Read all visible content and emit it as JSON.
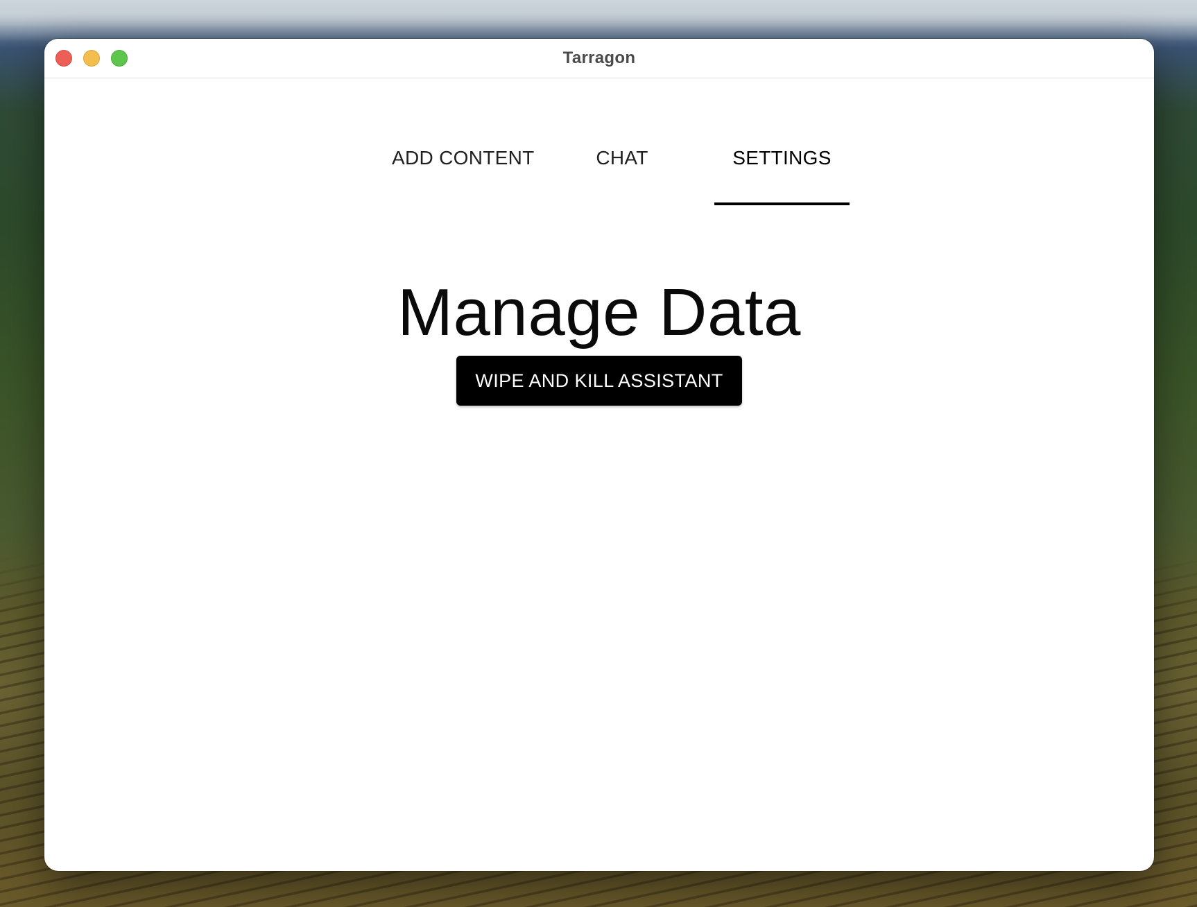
{
  "window": {
    "title": "Tarragon"
  },
  "tabs": [
    {
      "label": "ADD CONTENT",
      "active": false
    },
    {
      "label": "CHAT",
      "active": false
    },
    {
      "label": "SETTINGS",
      "active": true
    }
  ],
  "settings": {
    "heading": "Manage Data",
    "wipe_button_label": "WIPE AND KILL ASSISTANT"
  },
  "colors": {
    "accent": "#000000",
    "background": "#ffffff",
    "close_light": "#ec5f57",
    "minimize_light": "#f4be4f",
    "zoom_light": "#5ec64c"
  }
}
